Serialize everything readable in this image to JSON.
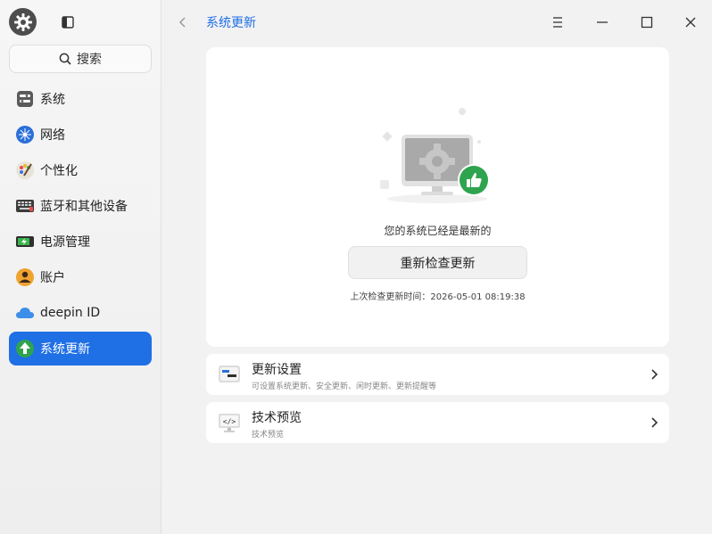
{
  "sidebar": {
    "search_label": "搜索",
    "items": [
      {
        "label": "系统",
        "icon": "system-icon"
      },
      {
        "label": "网络",
        "icon": "network-icon"
      },
      {
        "label": "个性化",
        "icon": "personalization-icon"
      },
      {
        "label": "蓝牙和其他设备",
        "icon": "bluetooth-devices-icon"
      },
      {
        "label": "电源管理",
        "icon": "power-icon"
      },
      {
        "label": "账户",
        "icon": "account-icon"
      },
      {
        "label": "deepin ID",
        "icon": "cloud-icon"
      },
      {
        "label": "系统更新",
        "icon": "update-icon",
        "active": true
      }
    ]
  },
  "header": {
    "title": "系统更新"
  },
  "main": {
    "status": "您的系统已经是最新的",
    "check_button": "重新检查更新",
    "last_check": "上次检查更新时间：2026-05-01 08:19:38"
  },
  "rows": [
    {
      "title": "更新设置",
      "subtitle": "可设置系统更新、安全更新、闲时更新、更新提醒等",
      "icon": "update-settings-icon"
    },
    {
      "title": "技术预览",
      "subtitle": "技术预览",
      "icon": "tech-preview-icon"
    }
  ],
  "colors": {
    "accent": "#1f6fe5",
    "badge_green": "#2fa44f"
  }
}
